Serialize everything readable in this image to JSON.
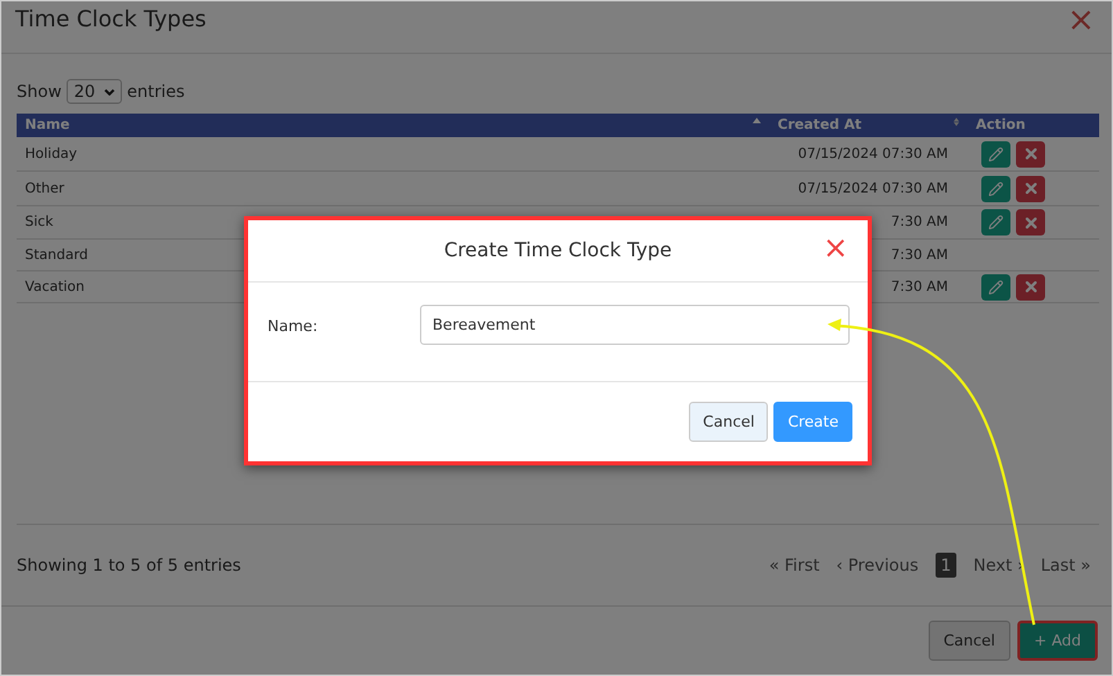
{
  "window": {
    "title": "Time Clock Types",
    "close": "×"
  },
  "length": {
    "label_before": "Show",
    "value": "20",
    "label_after": "entries"
  },
  "table": {
    "columns": [
      {
        "label": "Name",
        "sorted": true
      },
      {
        "label": "Created At",
        "sorted": false
      },
      {
        "label": "Action"
      }
    ],
    "rows": [
      {
        "name": "Holiday",
        "created_at": "07/15/2024 07:30 AM",
        "actions": true
      },
      {
        "name": "Other",
        "created_at": "07/15/2024 07:30 AM",
        "actions": true
      },
      {
        "name": "Sick",
        "created_at": "7:30 AM",
        "actions": true
      },
      {
        "name": "Standard",
        "created_at": "7:30 AM",
        "actions": false
      },
      {
        "name": "Vacation",
        "created_at": "7:30 AM",
        "actions": true
      }
    ]
  },
  "info": "Showing 1 to 5 of 5 entries",
  "pagination": [
    {
      "label": "« First",
      "kind": "nav"
    },
    {
      "label": "‹ Previous",
      "kind": "nav"
    },
    {
      "label": "1",
      "kind": "page",
      "selected": true
    },
    {
      "label": "Next ›",
      "kind": "nav"
    },
    {
      "label": "Last »",
      "kind": "nav"
    }
  ],
  "footer_buttons": [
    {
      "label": "Cancel",
      "kind": "default"
    },
    {
      "label": "+ Add",
      "kind": "primary",
      "highlighted": true
    }
  ],
  "dialog": {
    "title": "Create Time Clock Type",
    "close": "×",
    "field_label": "Name:",
    "field_value": "Bereavement",
    "buttons": [
      {
        "label": "Cancel",
        "kind": "default"
      },
      {
        "label": "Create",
        "kind": "primary"
      }
    ]
  }
}
